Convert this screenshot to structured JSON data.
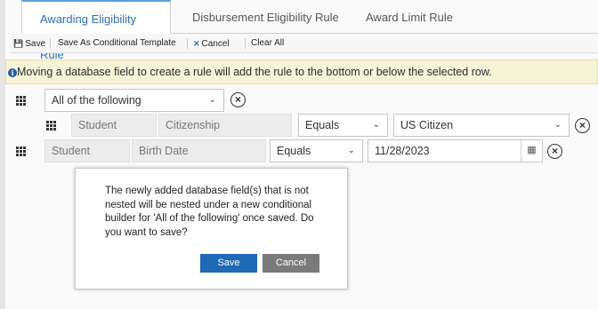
{
  "tabs": [
    {
      "label": "Awarding Eligibility Rule",
      "active": true
    },
    {
      "label": "Disbursement Eligibility Rule",
      "active": false
    },
    {
      "label": "Award Limit Rule",
      "active": false
    }
  ],
  "toolbar": {
    "save_label": "Save",
    "save_conditional_label": "Save As Conditional Template",
    "cancel_label": "Cancel",
    "clear_all_label": "Clear All"
  },
  "notice": {
    "text": "Moving a database field to create a rule will add the rule to the bottom or below the selected row."
  },
  "builder": {
    "group_value": "All of the following",
    "rule1": {
      "entity": "Student",
      "field": "Citizenship",
      "operator": "Equals",
      "value": "US Citizen"
    },
    "rule2": {
      "entity": "Student",
      "field": "Birth Date",
      "operator": "Equals",
      "value": "11/28/2023"
    }
  },
  "icons": {
    "remove": "circle-x-icon",
    "calendar": "calendar-icon",
    "grip": "drag-handle-icon",
    "caret": "chevron-down-icon"
  },
  "modal": {
    "message": "The newly added database field(s) that is not nested will be nested under a new conditional builder for 'All of the following' once saved. Do you want to save?",
    "save_label": "Save",
    "cancel_label": "Cancel"
  },
  "colors": {
    "accent": "#1f6ab7",
    "tab_active_text": "#2f6fb0",
    "notice_bg": "#f7f3d6",
    "cancel_bg": "#7a7a7a"
  }
}
